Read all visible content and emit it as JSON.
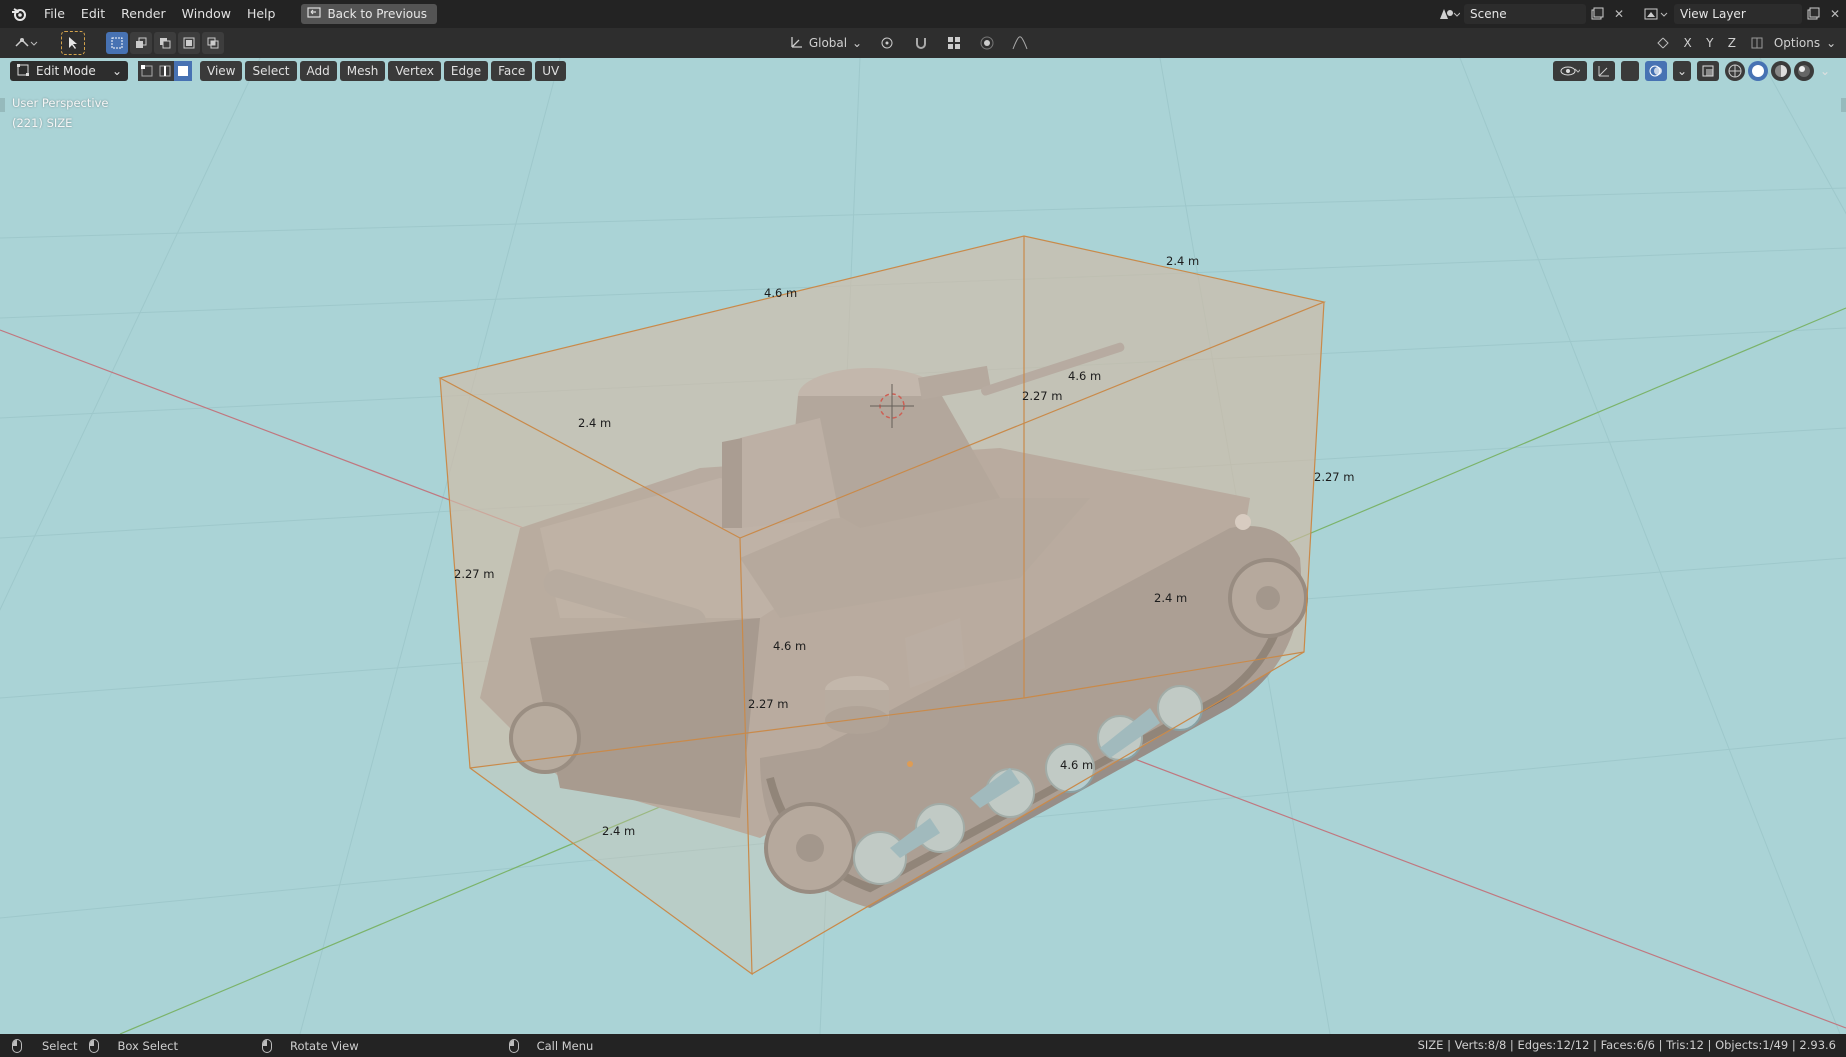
{
  "topbar": {
    "menus": [
      "File",
      "Edit",
      "Render",
      "Window",
      "Help"
    ],
    "back_button": "Back to Previous",
    "scene_name": "Scene",
    "view_layer_name": "View Layer"
  },
  "toolheader": {
    "orientation": "Global",
    "axes": [
      "X",
      "Y",
      "Z"
    ],
    "options_label": "Options"
  },
  "viewheader": {
    "mode": "Edit Mode",
    "menus": [
      "View",
      "Select",
      "Add",
      "Mesh",
      "Vertex",
      "Edge",
      "Face",
      "UV"
    ]
  },
  "viewport": {
    "view_name": "User Perspective",
    "object_info": "(221) SIZE",
    "dimension_labels": [
      "2.4 m",
      "4.6 m",
      "4.6 m",
      "2.27 m",
      "2.4 m",
      "2.27 m",
      "2.27 m",
      "2.4 m",
      "4.6 m",
      "2.27 m",
      "4.6 m",
      "2.4 m"
    ]
  },
  "statusbar": {
    "select": "Select",
    "box_select": "Box Select",
    "rotate_view": "Rotate View",
    "call_menu": "Call Menu",
    "stats": "SIZE | Verts:8/8 | Edges:12/12 | Faces:6/6 | Tris:12 | Objects:1/49 | 2.93.6"
  },
  "colors": {
    "viewport_bg": "#a9d3d6",
    "box_edge": "#c98a4a",
    "x_axis": "#c0777f",
    "y_axis": "#7bb36a",
    "accent": "#4772b3"
  }
}
